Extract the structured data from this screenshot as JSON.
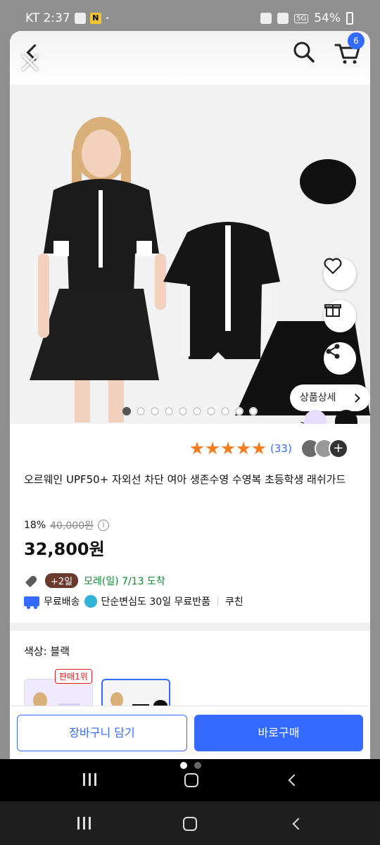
{
  "status_bar": {
    "carrier_time": "KT 2:37",
    "notif_n": "N",
    "network": "5G",
    "battery": "54%",
    "icons": [
      "signal-icon",
      "wifi-icon",
      "alarm-icon",
      "battery-icon"
    ]
  },
  "header": {
    "cart_count": "6",
    "icons": [
      "back-arrow-icon",
      "close-icon",
      "search-icon",
      "cart-icon"
    ]
  },
  "gallery": {
    "detail_button": "상품상세 >",
    "page_count": 10,
    "active_index": 0,
    "side_actions": [
      "heart-icon",
      "gift-icon",
      "share-icon"
    ]
  },
  "product": {
    "review_count": "(33)",
    "rating": 5,
    "reviewer_more": "+",
    "title": "오르웨인 UPF50+ 자외선 차단 여아 생존수영 수영복 초등학생 래쉬가드",
    "discount": "18%",
    "original_price": "40,000원",
    "price": "32,800원",
    "delivery_tag": "+2일",
    "delivery_date": "모레(일) 7/13 도착",
    "free_shipping": "무료배송",
    "free_return": "단순변심도 30일 무료반품",
    "coupang": "쿠친",
    "info_icon": "i"
  },
  "options": {
    "color_label": "색상: 블랙",
    "best_badge": "판매1위"
  },
  "actions": {
    "add_to_cart": "장바구니 담기",
    "buy_now": "바로구매"
  },
  "colors": {
    "accent": "#346aff",
    "delivery_green": "#0a8a2f",
    "star": "#f57c1f",
    "badge_red": "#e02020"
  }
}
